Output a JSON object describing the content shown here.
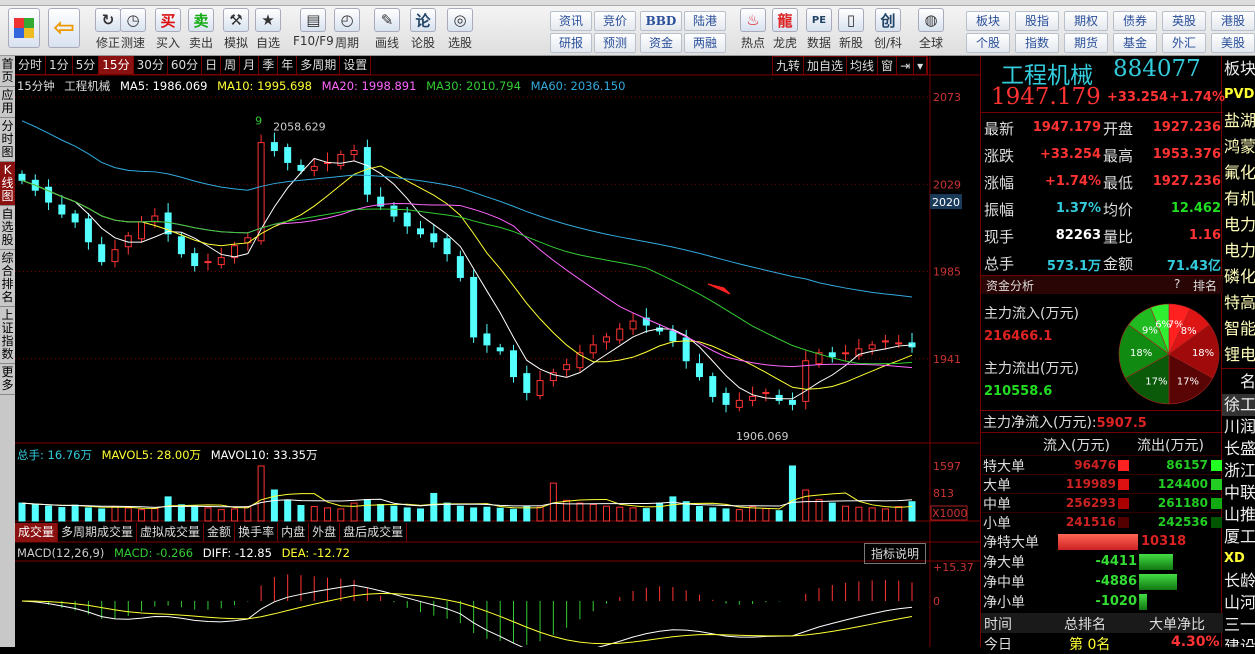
{
  "toolbar": {
    "buttons": [
      {
        "label": "",
        "icon": "windows-logo-icon"
      },
      {
        "label": "",
        "icon": "back-arrow-icon"
      },
      {
        "label": "修正",
        "icon": "refresh-icon"
      },
      {
        "label": "测速",
        "icon": "clock-icon"
      },
      {
        "label": "买入",
        "icon": "buy-icon",
        "glyph": "买"
      },
      {
        "label": "卖出",
        "icon": "sell-icon",
        "glyph": "卖"
      },
      {
        "label": "模拟",
        "icon": "gavel-icon"
      },
      {
        "label": "自选",
        "icon": "star-folder-icon"
      },
      {
        "label": "F10/F9",
        "icon": "document-icon"
      },
      {
        "label": "周期",
        "icon": "period-clock-icon"
      },
      {
        "label": "画线",
        "icon": "pencil-icon"
      },
      {
        "label": "论股",
        "icon": "forum-icon",
        "glyph": "论"
      },
      {
        "label": "选股",
        "icon": "stock-picker-icon"
      }
    ],
    "small_buttons": [
      [
        "资讯",
        "研报"
      ],
      [
        "竞价",
        "预测"
      ],
      [
        "BBD",
        "资金"
      ],
      [
        "陆港",
        "两融"
      ]
    ],
    "buttons2": [
      {
        "label": "热点",
        "icon": "hot-icon"
      },
      {
        "label": "龙虎",
        "icon": "dragon-icon"
      },
      {
        "label": "数据",
        "icon": "pe-data-icon"
      },
      {
        "label": "新股",
        "icon": "ipo-icon"
      },
      {
        "label": "创/科",
        "icon": "chuang-icon",
        "glyph": "创"
      },
      {
        "label": "全球",
        "icon": "globe-icon"
      }
    ],
    "market_buttons": [
      [
        "板块",
        "个股"
      ],
      [
        "股指",
        "指数"
      ],
      [
        "期权",
        "期货"
      ],
      [
        "债券",
        "基金"
      ],
      [
        "英股",
        "外汇"
      ],
      [
        "港股",
        "美股"
      ]
    ]
  },
  "left_tabs": [
    {
      "label": "首页"
    },
    {
      "label": "应用"
    },
    {
      "label": "分时图"
    },
    {
      "label": "K线图",
      "active": true
    },
    {
      "label": "自选股"
    },
    {
      "label": "综合排名"
    },
    {
      "label": "上证指数"
    },
    {
      "label": "更多"
    }
  ],
  "periods": [
    {
      "label": "分时"
    },
    {
      "label": "1分"
    },
    {
      "label": "5分"
    },
    {
      "label": "15分",
      "active": true
    },
    {
      "label": "30分"
    },
    {
      "label": "60分"
    },
    {
      "label": "日"
    },
    {
      "label": "周"
    },
    {
      "label": "月"
    },
    {
      "label": "季"
    },
    {
      "label": "年"
    },
    {
      "label": "多周期"
    },
    {
      "label": "设置"
    }
  ],
  "chart_tools": [
    "九转",
    "加自选",
    "均线",
    "窗",
    "⇥",
    "▾"
  ],
  "ma_legend": {
    "period": "15分钟",
    "name": "工程机械",
    "ma5": "MA5: 1986.069",
    "ma10": "MA10: 1995.698",
    "ma20": "MA20: 1998.891",
    "ma30": "MA30: 2010.794",
    "ma60": "MA60: 2036.150"
  },
  "colors": {
    "up": "#ff3333",
    "down": "#54ffff",
    "ma5": "#ffffff",
    "ma10": "#ffff33",
    "ma20": "#ff66ff",
    "ma30": "#33cc33",
    "ma60": "#33aadd",
    "grid": "#770000"
  },
  "price_axis": {
    "ticks": [
      "2073",
      "2029",
      "1985",
      "1941"
    ],
    "current_tag": "2020",
    "min": 1897,
    "max": 2073
  },
  "annotations": {
    "high": "2058.629",
    "low": "1906.069",
    "nine_high": "9"
  },
  "chart_data": {
    "type": "candlestick",
    "closes": [
      2031,
      2026,
      2020,
      2014,
      2010,
      2000,
      1990,
      1996,
      2003,
      2010,
      2013,
      2004,
      1994,
      1988,
      1990,
      1992,
      1998,
      2002,
      2050,
      2046,
      2040,
      2036,
      2038,
      2040,
      2044,
      2046,
      2024,
      2018,
      2013,
      2008,
      2004,
      2000,
      1994,
      1982,
      1952,
      1948,
      1945,
      1932,
      1924,
      1930,
      1934,
      1938,
      1944,
      1948,
      1952,
      1956,
      1960,
      1958,
      1955,
      1950,
      1940,
      1932,
      1922,
      1918,
      1920,
      1922,
      1924,
      1920,
      1918,
      1940,
      1944,
      1942,
      1944,
      1946,
      1948,
      1950,
      1949,
      1947
    ],
    "volumes": [
      520,
      470,
      430,
      390,
      460,
      380,
      350,
      420,
      380,
      330,
      360,
      700,
      470,
      430,
      380,
      330,
      350,
      420,
      1597,
      900,
      600,
      450,
      420,
      380,
      350,
      520,
      620,
      480,
      430,
      380,
      350,
      800,
      520,
      430,
      380,
      400,
      370,
      340,
      420,
      400,
      1100,
      600,
      520,
      480,
      430,
      400,
      380,
      360,
      520,
      700,
      560,
      420,
      380,
      350,
      330,
      420,
      360,
      300,
      1597,
      900,
      620,
      520,
      430,
      400,
      380,
      350,
      420,
      560
    ],
    "vol_ticks": [
      "1597",
      "813"
    ],
    "vol_unit": "X1000",
    "macd_ticks": [
      "+15.37",
      "0"
    ]
  },
  "vol_legend": {
    "total": "总手: 16.76万",
    "mavol5": "MAVOL5: 28.00万",
    "mavol10": "MAVOL10: 33.35万"
  },
  "indicator_tabs": [
    {
      "label": "成交量",
      "active": true
    },
    {
      "label": "多周期成交量"
    },
    {
      "label": "虚拟成交量"
    },
    {
      "label": "金额"
    },
    {
      "label": "换手率"
    },
    {
      "label": "内盘"
    },
    {
      "label": "外盘"
    },
    {
      "label": "盘后成交量"
    }
  ],
  "macd_legend": {
    "name": "MACD(12,26,9)",
    "macd": "MACD: -0.266",
    "diff": "DIFF: -12.85",
    "dea": "DEA: -12.72",
    "help": "指标说明"
  },
  "quote": {
    "name": "工程机械",
    "code": "884077",
    "price": "1947.179",
    "change": "+33.254",
    "pct": "+1.74%",
    "rows": [
      [
        "最新",
        "1947.179",
        "开盘",
        "1927.236"
      ],
      [
        "涨跌",
        "+33.254",
        "最高",
        "1953.376"
      ],
      [
        "涨幅",
        "+1.74%",
        "最低",
        "1927.236"
      ],
      [
        "振幅",
        "1.37%",
        "均价",
        "12.462"
      ],
      [
        "现手",
        "82263",
        "量比",
        "1.16"
      ],
      [
        "总手",
        "573.1万",
        "金额",
        "71.43亿"
      ]
    ]
  },
  "fund": {
    "title": "资金分析",
    "help": "?",
    "rank": "排名",
    "inflow_label": "主力流入(万元)",
    "inflow": "216466.1",
    "outflow_label": "主力流出(万元)",
    "outflow": "210558.6",
    "net_label": "主力净流入(万元):",
    "net": "5907.5",
    "pie": [
      {
        "pct": 7,
        "label": "7%",
        "color": "#ff2020"
      },
      {
        "pct": 8,
        "label": "8%",
        "color": "#dd1515"
      },
      {
        "pct": 18,
        "label": "18%",
        "color": "#a00a0a"
      },
      {
        "pct": 17,
        "label": "17%",
        "color": "#5a0505"
      },
      {
        "pct": 17,
        "label": "17%",
        "color": "#0a5a0a"
      },
      {
        "pct": 18,
        "label": "18%",
        "color": "#108a10"
      },
      {
        "pct": 9,
        "label": "9%",
        "color": "#20bb20"
      },
      {
        "pct": 6,
        "label": "6%",
        "color": "#30ee30"
      }
    ],
    "table_header": [
      "流入(万元)",
      "流出(万元)"
    ],
    "table": [
      [
        "特大单",
        "96476",
        "86157"
      ],
      [
        "大单",
        "119989",
        "124400"
      ],
      [
        "中单",
        "256293",
        "261180"
      ],
      [
        "小单",
        "241516",
        "242536"
      ]
    ],
    "net_rows": [
      {
        "label": "净特大单",
        "value": "10318",
        "num": 10318
      },
      {
        "label": "净大单",
        "value": "-4411",
        "num": -4411
      },
      {
        "label": "净中单",
        "value": "-4886",
        "num": -4886
      },
      {
        "label": "净小单",
        "value": "-1020",
        "num": -1020
      }
    ],
    "rank_header": [
      "时间",
      "总排名",
      "大单净比"
    ],
    "rank_row": [
      "今日",
      "第 0名",
      "4.30%"
    ]
  },
  "far_list": {
    "sectors": [
      "板块",
      "PVDF",
      "盐湖",
      "鸿蒙",
      "氟化",
      "有机",
      "电力",
      "电力",
      "磷化",
      "特高",
      "智能",
      "锂电"
    ],
    "header": "名",
    "stocks": [
      "徐工",
      "川润",
      "长盛",
      "浙江",
      "中联",
      "山推",
      "厦工",
      "XD",
      "长龄",
      "山河",
      "三一",
      "建设"
    ]
  }
}
